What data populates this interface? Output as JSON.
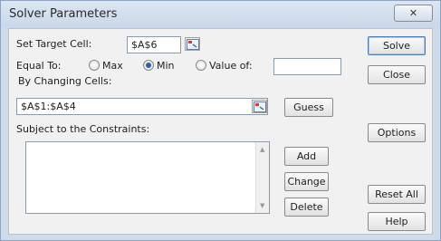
{
  "window": {
    "title": "Solver Parameters",
    "close_glyph": "✕"
  },
  "target": {
    "label": "Set Target Cell:",
    "value": "$A$6"
  },
  "equal_to": {
    "label": "Equal To:",
    "options": [
      {
        "label": "Max",
        "selected": false
      },
      {
        "label": "Min",
        "selected": true
      },
      {
        "label": "Value of:",
        "selected": false
      }
    ],
    "value_of": ""
  },
  "changing": {
    "label": "By Changing Cells:",
    "value": "$A$1:$A$4"
  },
  "constraints": {
    "label": "Subject to the Constraints:",
    "items": []
  },
  "buttons": {
    "solve": "Solve",
    "close": "Close",
    "guess": "Guess",
    "options": "Options",
    "add": "Add",
    "change": "Change",
    "delete": "Delete",
    "reset_all": "Reset All",
    "help": "Help"
  },
  "icons": {
    "collapse": "collapse-dialog-icon",
    "scroll_up": "scroll-up-icon",
    "scroll_down": "scroll-down-icon"
  }
}
